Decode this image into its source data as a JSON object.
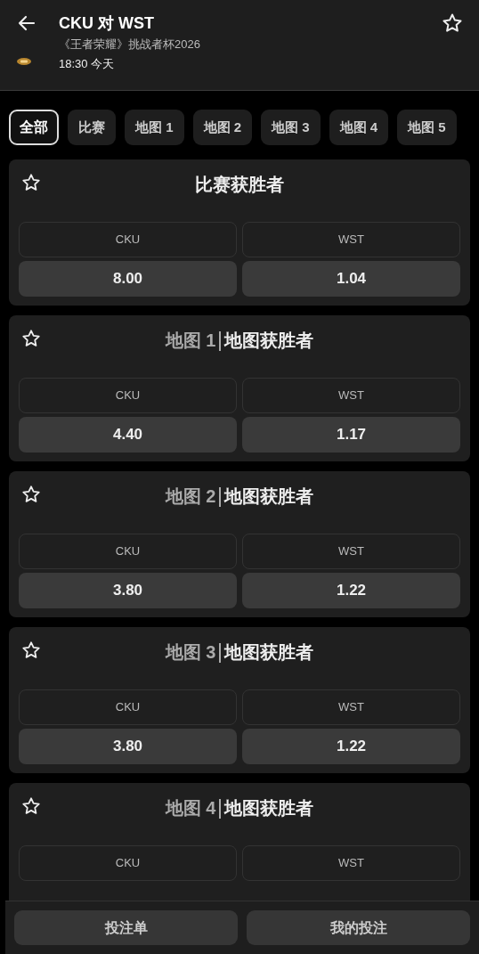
{
  "header": {
    "title": "CKU 对 WST",
    "tournament": "《王者荣耀》挑战者杯2026",
    "time": "18:30 今天"
  },
  "tabs": [
    {
      "label": "全部",
      "selected": true
    },
    {
      "label": "比赛",
      "selected": false
    },
    {
      "label": "地图 1",
      "selected": false
    },
    {
      "label": "地图 2",
      "selected": false
    },
    {
      "label": "地图 3",
      "selected": false
    },
    {
      "label": "地图 4",
      "selected": false
    },
    {
      "label": "地图 5",
      "selected": false
    }
  ],
  "markets": [
    {
      "title": "比赛获胜者",
      "outcomes": [
        {
          "team": "CKU",
          "odds": "8.00"
        },
        {
          "team": "WST",
          "odds": "1.04"
        }
      ]
    },
    {
      "prefix": "地图 1",
      "title": "地图获胜者",
      "outcomes": [
        {
          "team": "CKU",
          "odds": "4.40"
        },
        {
          "team": "WST",
          "odds": "1.17"
        }
      ]
    },
    {
      "prefix": "地图 2",
      "title": "地图获胜者",
      "outcomes": [
        {
          "team": "CKU",
          "odds": "3.80"
        },
        {
          "team": "WST",
          "odds": "1.22"
        }
      ]
    },
    {
      "prefix": "地图 3",
      "title": "地图获胜者",
      "outcomes": [
        {
          "team": "CKU",
          "odds": "3.80"
        },
        {
          "team": "WST",
          "odds": "1.22"
        }
      ]
    },
    {
      "prefix": "地图 4",
      "title": "地图获胜者",
      "outcomes": [
        {
          "team": "CKU"
        },
        {
          "team": "WST"
        }
      ]
    }
  ],
  "bottom_bar": [
    "投注单",
    "我的投注"
  ]
}
